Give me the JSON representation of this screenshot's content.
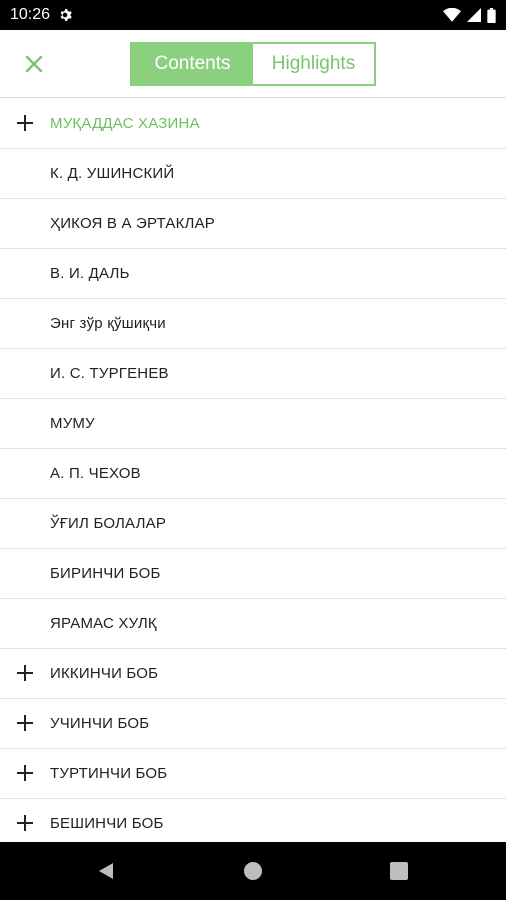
{
  "status": {
    "time": "10:26"
  },
  "toolbar": {
    "tabs": [
      {
        "label": "Contents",
        "active": true
      },
      {
        "label": "Highlights",
        "active": false
      }
    ]
  },
  "colors": {
    "accent": "#8bd07f",
    "accent_text": "#6cbf5e"
  },
  "toc": {
    "items": [
      {
        "label": "МУҚАДДАС ХАЗИНА",
        "expandable": true,
        "highlight": true
      },
      {
        "label": "К. Д. УШИНСКИЙ",
        "expandable": false
      },
      {
        "label": "ҲИКОЯ В А ЭРТАКЛАР",
        "expandable": false
      },
      {
        "label": "В. И. ДАЛЬ",
        "expandable": false
      },
      {
        "label": "Энг зўр қўшиқчи",
        "expandable": false
      },
      {
        "label": "И. С. ТУРГЕНЕВ",
        "expandable": false
      },
      {
        "label": "МУМУ",
        "expandable": false
      },
      {
        "label": "А. П. ЧЕХОВ",
        "expandable": false
      },
      {
        "label": "ЎҒИЛ БОЛАЛАР",
        "expandable": false
      },
      {
        "label": "БИРИНЧИ БОБ",
        "expandable": false
      },
      {
        "label": "ЯРАМАС ХУЛҚ",
        "expandable": false
      },
      {
        "label": "ИККИНЧИ БОБ",
        "expandable": true
      },
      {
        "label": "УЧИНЧИ БОБ",
        "expandable": true
      },
      {
        "label": "ТУРТИНЧИ БОБ",
        "expandable": true
      },
      {
        "label": "БЕШИНЧИ БОБ",
        "expandable": true
      }
    ]
  }
}
